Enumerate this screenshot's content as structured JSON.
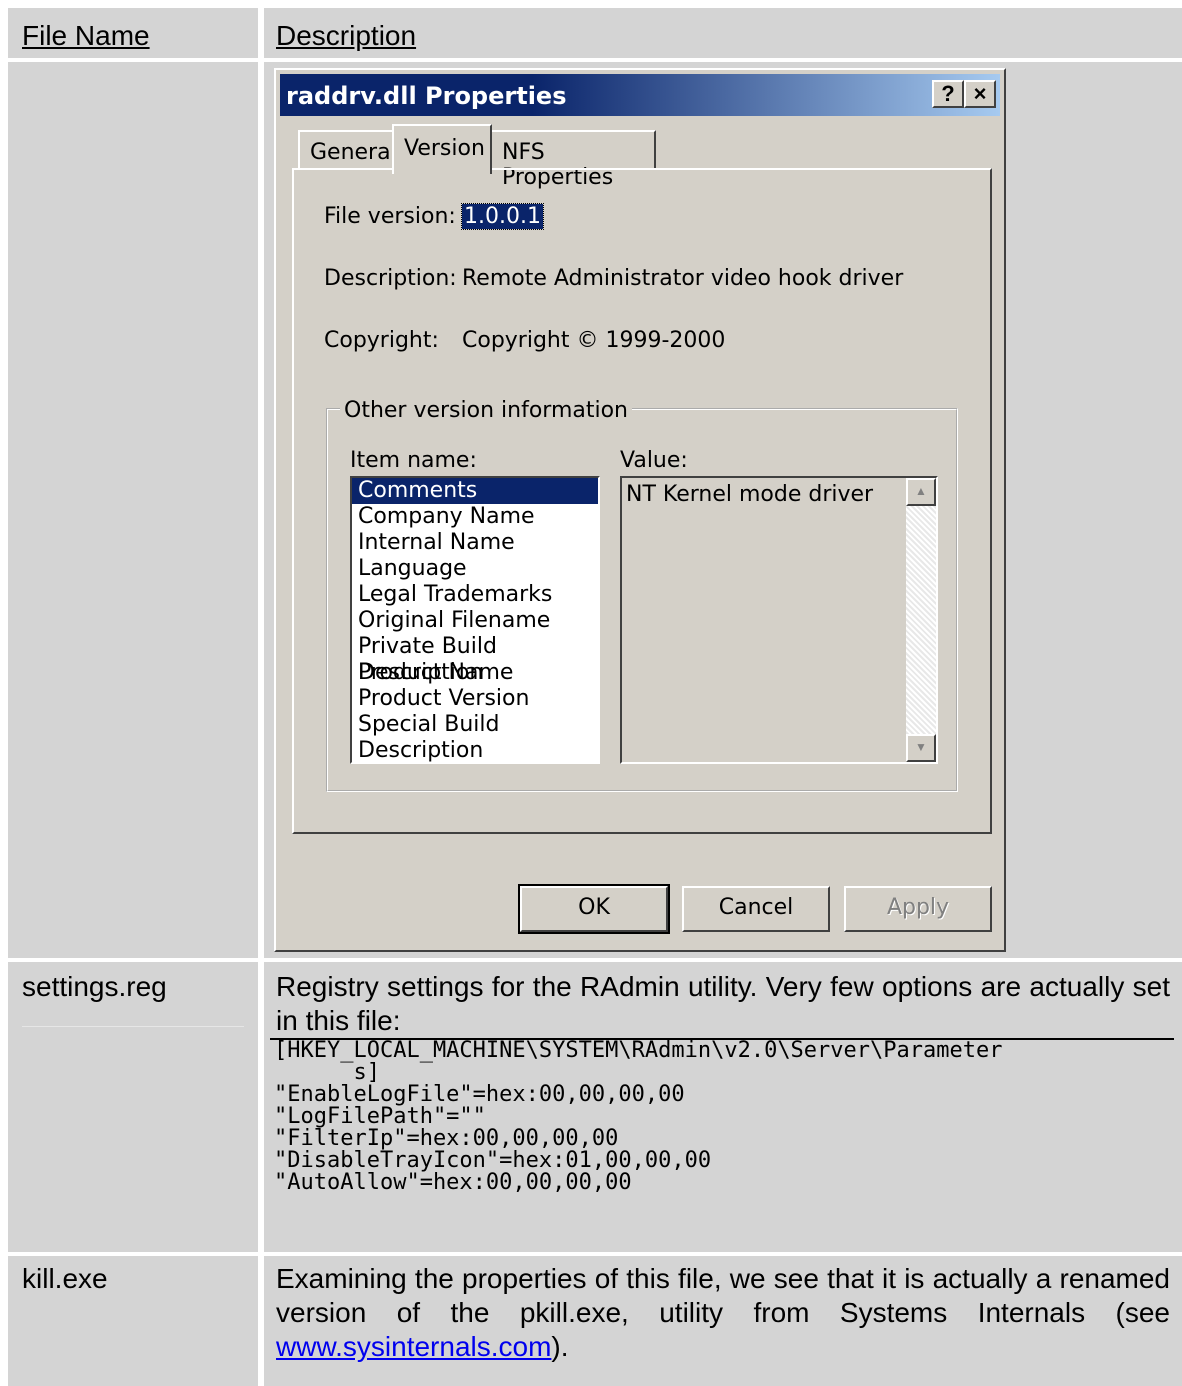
{
  "table": {
    "headers": [
      "File Name",
      "Description"
    ],
    "rows": [
      {
        "file": "settings.reg",
        "description": "Registry settings for the RAdmin utility.  Very few options are actually set in this file:",
        "registry_lines": [
          "[HKEY_LOCAL_MACHINE\\SYSTEM\\RAdmin\\v2.0\\Server\\Parameter",
          "      s]",
          "\"EnableLogFile\"=hex:00,00,00,00",
          "\"LogFilePath\"=\"\"",
          "\"FilterIp\"=hex:00,00,00,00",
          "\"DisableTrayIcon\"=hex:01,00,00,00",
          "\"AutoAllow\"=hex:00,00,00,00"
        ]
      },
      {
        "file": "kill.exe",
        "description_pre": "Examining the properties of this file, we see that it is actually a renamed version of the pkill.exe, utility from Systems Internals (see ",
        "link": "www.sysinternals.com",
        "description_post": ")."
      }
    ]
  },
  "dialog": {
    "title": "raddrv.dll Properties",
    "help_btn": "?",
    "close_btn": "×",
    "tabs": [
      "General",
      "Version",
      "NFS Properties"
    ],
    "active_tab": "Version",
    "fields": {
      "file_version_label": "File version:",
      "file_version": "1.0.0.1",
      "description_label": "Description:",
      "description": "Remote Administrator video hook driver",
      "copyright_label": "Copyright:",
      "copyright": "Copyright © 1999-2000"
    },
    "group_label": "Other version information",
    "item_name_label": "Item name:",
    "value_label": "Value:",
    "items": [
      "Comments",
      "Company Name",
      "Internal Name",
      "Language",
      "Legal Trademarks",
      "Original Filename",
      "Private Build Description",
      "Product Name",
      "Product Version",
      "Special Build Description"
    ],
    "selected_item": "Comments",
    "value": "NT Kernel mode driver",
    "buttons": {
      "ok": "OK",
      "cancel": "Cancel",
      "apply": "Apply"
    }
  }
}
